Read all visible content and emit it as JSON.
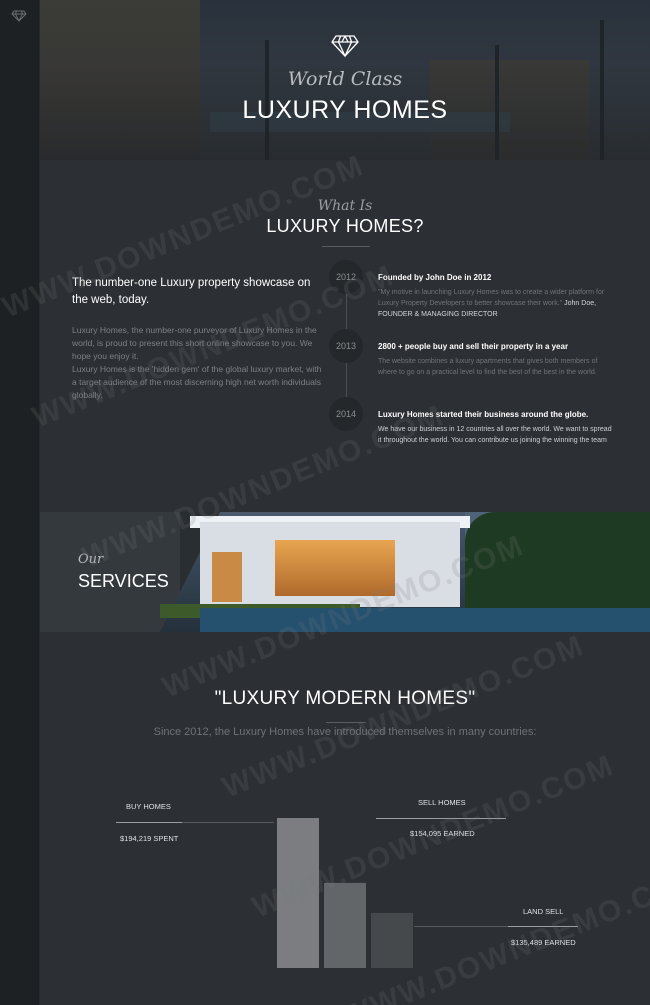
{
  "hero": {
    "subtitle": "World Class",
    "title": "LUXURY HOMES"
  },
  "about": {
    "subtitle": "What Is",
    "title": "LUXURY HOMES?",
    "heading": "The number-one Luxury property showcase on the web, today.",
    "body": "Luxury Homes, the number-one purveyor of Luxury Homes in the world, is proud to present this short online showcase to you. We hope you enjoy it.\nLuxury Homes is the 'hidden gem' of the global luxury market, with a target audience of the most discerning high net worth individuals globally."
  },
  "timeline": [
    {
      "year": "2012",
      "heading": "Founded by John Doe in 2012",
      "text": "\"My motive in launching Luxury Homes was to create a wider platform for Luxury Property Developers to better showcase their work.\"",
      "author": "John Doe, FOUNDER & MANAGING DIRECTOR"
    },
    {
      "year": "2013",
      "heading": "2800 + people buy and sell their property in a year",
      "text": "The website combines a luxury apartments that gives both members of where to go on a practical level to find the best of the best in the world."
    },
    {
      "year": "2014",
      "heading": "Luxury Homes started their business around the globe.",
      "text": "We have our business in 12 countries all over the world. We want to spread it throughout the world. You can contribute us joining the winning the team"
    }
  ],
  "services": {
    "subtitle": "Our",
    "title": "SERVICES"
  },
  "modern": {
    "title": "\"LUXURY MODERN HOMES\"",
    "subtitle": "Since 2012, the Luxury Homes have introduced themselves in many countries:"
  },
  "chart_data": {
    "type": "bar",
    "categories": [
      "BUY HOMES",
      "SELL HOMES",
      "LAND SELL"
    ],
    "values": [
      194219,
      154095,
      135489
    ],
    "value_labels": [
      "$194,219 SPENT",
      "$154,095 EARNED",
      "$135,489 EARNED"
    ],
    "colors": [
      "#7b7d80",
      "#636669",
      "#46494c"
    ]
  },
  "watermark": "WWW.DOWNDEMO.COM"
}
